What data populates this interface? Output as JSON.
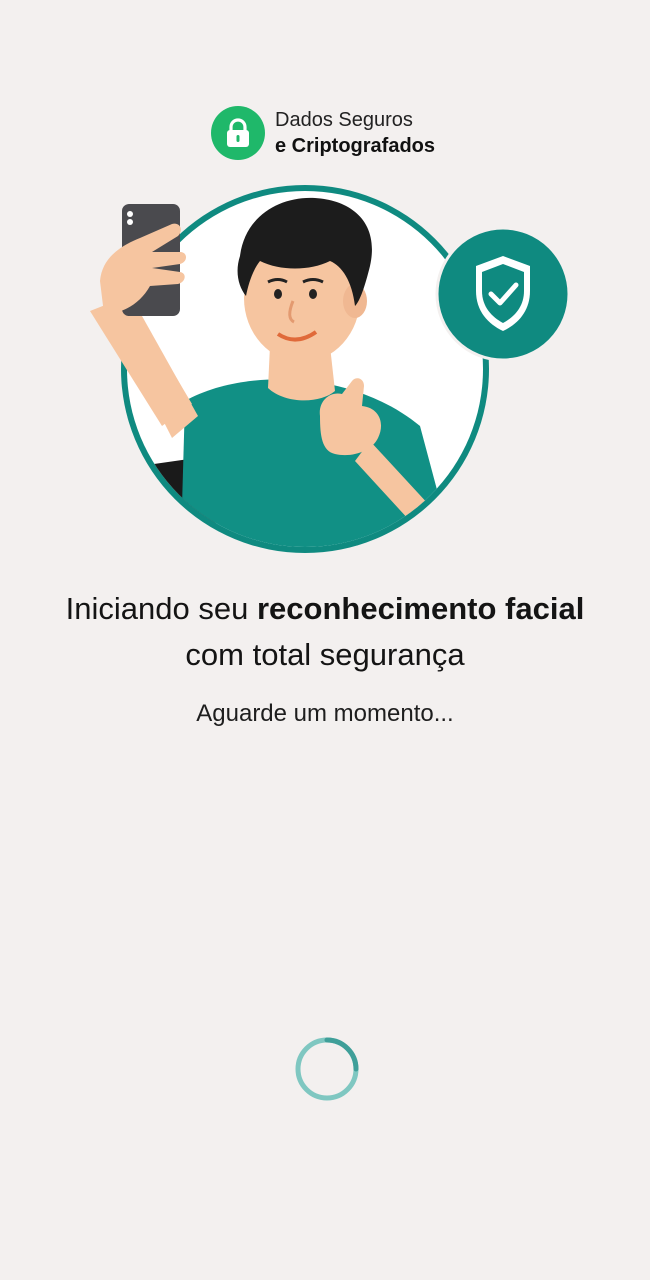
{
  "badge": {
    "line1": "Dados Seguros",
    "line2": "e Criptografados",
    "icon": "lock-icon",
    "color": "#1fb86a"
  },
  "illustration": {
    "description_icon": "person-selfie-illustration",
    "shield_icon": "shield-check-icon",
    "accent": "#0f8a80"
  },
  "headline": {
    "part1": "Iniciando seu ",
    "bold": "reconhecimento facial",
    "line2": "com total segurança"
  },
  "subtext": "Aguarde um momento...",
  "spinner": {
    "icon": "loading-spinner-icon",
    "color": "#4fb0aa"
  }
}
